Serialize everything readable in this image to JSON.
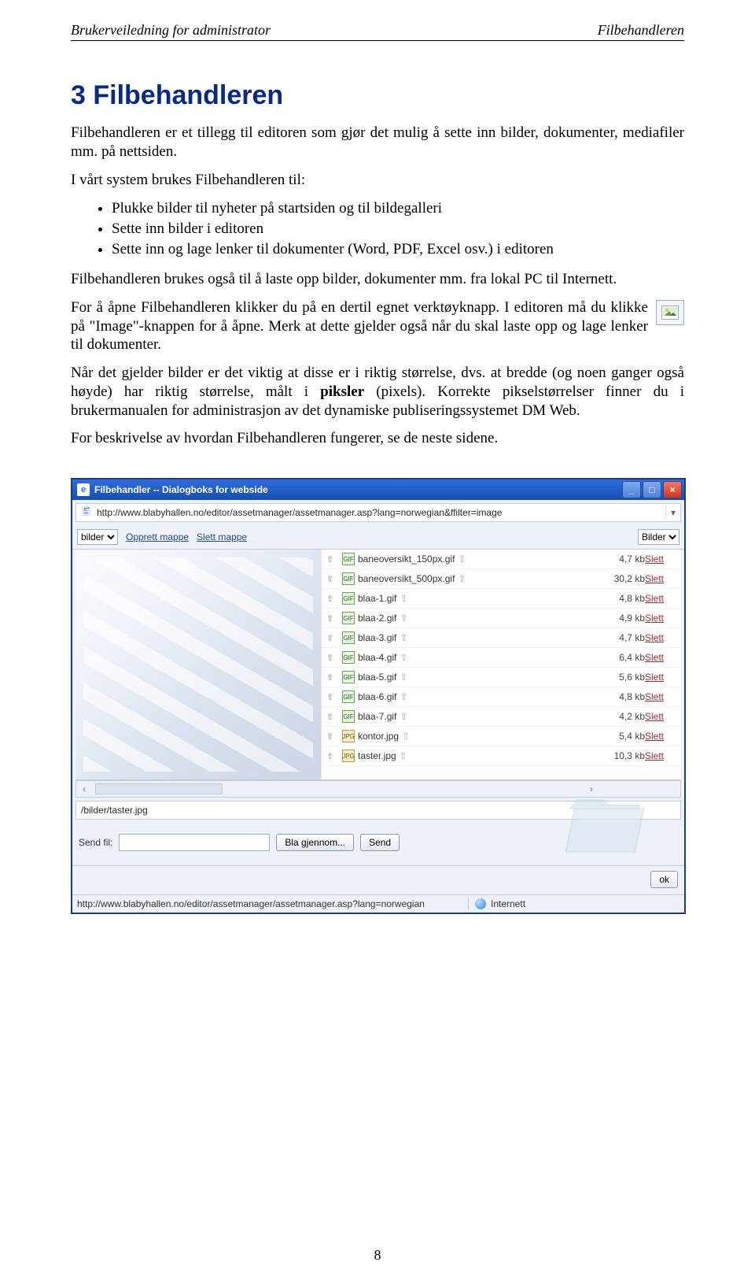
{
  "header": {
    "left": "Brukerveiledning for administrator",
    "right": "Filbehandleren"
  },
  "h1": "3 Filbehandleren",
  "intro": "Filbehandleren er et tillegg til editoren som gjør det mulig å sette inn bilder, dokumenter, mediafiler mm. på nettsiden.",
  "uses_intro": "I vårt system brukes Filbehandleren til:",
  "uses": [
    "Plukke bilder til nyheter på startsiden og til bildegalleri",
    "Sette inn bilder i editoren",
    "Sette inn og lage lenker til dokumenter (Word, PDF, Excel osv.) i editoren"
  ],
  "p1": "Filbehandleren brukes også til å laste opp bilder, dokumenter mm. fra lokal PC til Internett.",
  "p2": "For å åpne Filbehandleren klikker du på en dertil egnet verktøyknapp. I editoren må du klikke på \"Image\"-knappen for å åpne. Merk at dette gjelder også når du skal laste opp og lage lenker til dokumenter.",
  "p3a": "Når det gjelder bilder er det viktig at disse er i riktig størrelse, dvs. at bredde (og noen ganger også høyde) har riktig størrelse, målt i ",
  "p3strong": "piksler",
  "p3b": " (pixels). Korrekte pikselstørrelser finner du i brukermanualen for administrasjon av det dynamiske publiseringssystemet DM Web.",
  "p4": "For beskrivelse av hvordan Filbehandleren fungerer, se de neste sidene.",
  "dialog": {
    "title": "Filbehandler -- Dialogboks for webside",
    "url": "http://www.blabyhallen.no/editor/assetmanager/assetmanager.asp?lang=norwegian&ffilter=image",
    "folder_select": "bilder",
    "link_create": "Opprett mappe",
    "link_delete": "Slett mappe",
    "type_select": "Bilder",
    "files": [
      {
        "name": "baneoversikt_150px.gif",
        "type": "gif",
        "size": "4,7 kb"
      },
      {
        "name": "baneoversikt_500px.gif",
        "type": "gif",
        "size": "30,2 kb"
      },
      {
        "name": "blaa-1.gif",
        "type": "gif",
        "size": "4,8 kb"
      },
      {
        "name": "blaa-2.gif",
        "type": "gif",
        "size": "4,9 kb"
      },
      {
        "name": "blaa-3.gif",
        "type": "gif",
        "size": "4,7 kb"
      },
      {
        "name": "blaa-4.gif",
        "type": "gif",
        "size": "6,4 kb"
      },
      {
        "name": "blaa-5.gif",
        "type": "gif",
        "size": "5,6 kb"
      },
      {
        "name": "blaa-6.gif",
        "type": "gif",
        "size": "4,8 kb"
      },
      {
        "name": "blaa-7.gif",
        "type": "gif",
        "size": "4,2 kb"
      },
      {
        "name": "kontor.jpg",
        "type": "jpg",
        "size": "5,4 kb"
      },
      {
        "name": "taster.jpg",
        "type": "jpg",
        "size": "10,3 kb"
      }
    ],
    "delete_label": "Slett",
    "path": "/bilder/taster.jpg",
    "send_label": "Send fil:",
    "browse_btn": "Bla gjennom...",
    "send_btn": "Send",
    "ok_btn": "ok",
    "status_url": "http://www.blabyhallen.no/editor/assetmanager/assetmanager.asp?lang=norwegian",
    "zone": "Internett"
  },
  "page_number": "8"
}
